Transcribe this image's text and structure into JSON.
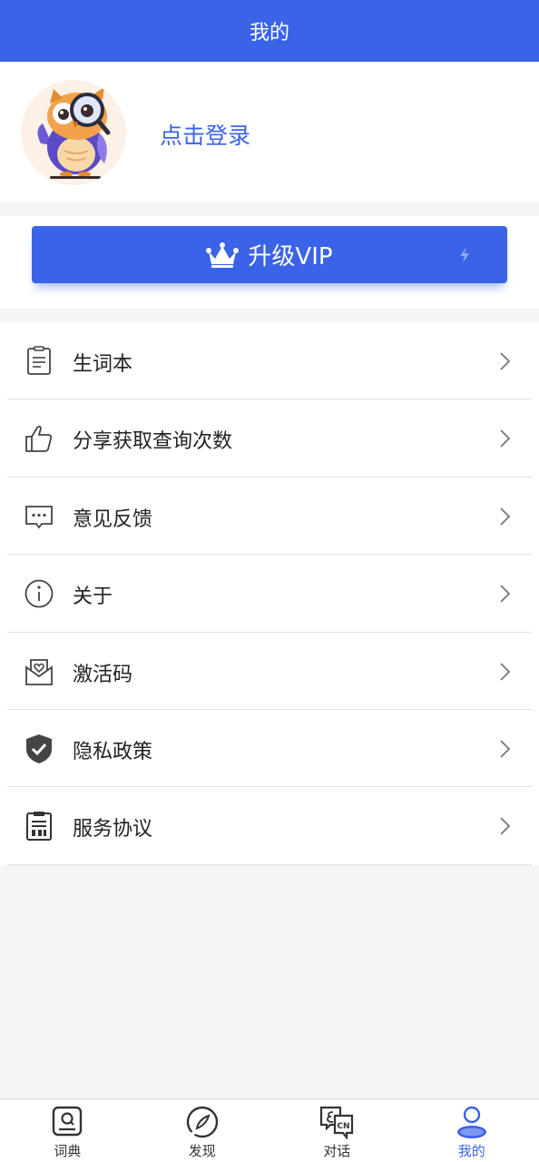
{
  "header": {
    "title": "我的"
  },
  "profile": {
    "login_text": "点击登录"
  },
  "vip": {
    "label": "升级VIP"
  },
  "menu": {
    "items": [
      {
        "label": "生词本"
      },
      {
        "label": "分享获取查询次数"
      },
      {
        "label": "意见反馈"
      },
      {
        "label": "关于"
      },
      {
        "label": "激活码"
      },
      {
        "label": "隐私政策"
      },
      {
        "label": "服务协议"
      }
    ]
  },
  "tabbar": {
    "tabs": [
      {
        "label": "词典"
      },
      {
        "label": "发现"
      },
      {
        "label": "对话"
      },
      {
        "label": "我的"
      }
    ],
    "active_index": 3
  },
  "colors": {
    "accent": "#3a63e8",
    "background": "#f5f5f5"
  }
}
